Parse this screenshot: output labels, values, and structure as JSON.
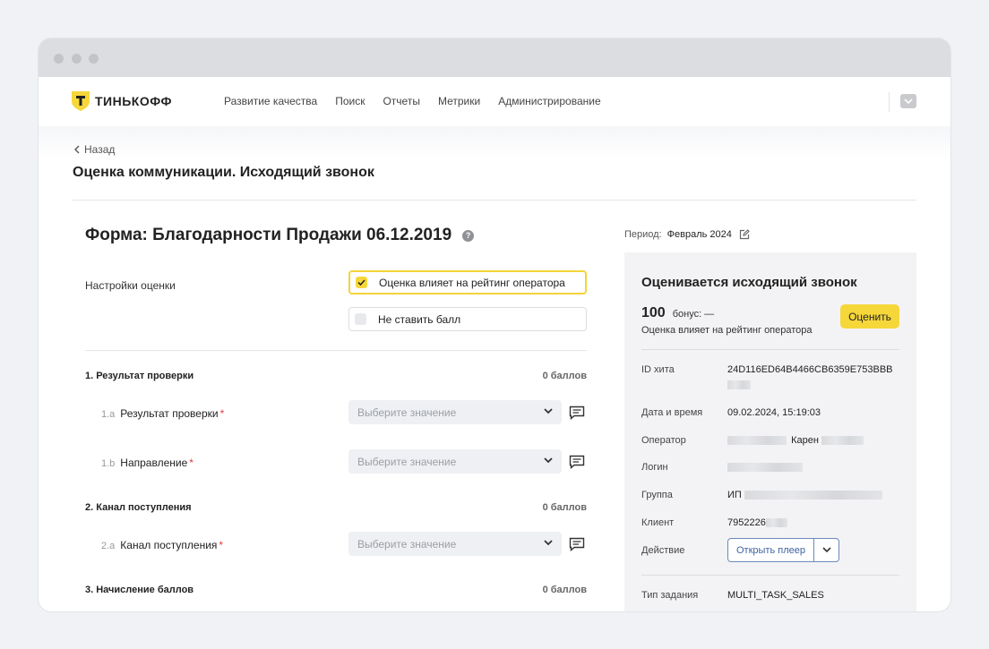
{
  "brand": {
    "name": "ТИНЬКОФФ",
    "accent": "#f6d73a"
  },
  "nav": {
    "items": [
      "Развитие качества",
      "Поиск",
      "Отчеты",
      "Метрики",
      "Администрирование"
    ]
  },
  "header": {
    "back_label": "Назад",
    "title": "Оценка коммуникации. Исходящий звонок"
  },
  "form": {
    "title": "Форма: Благодарности Продажи 06.12.2019",
    "settings_label": "Настройки оценки",
    "options": [
      {
        "label": "Оценка влияет на рейтинг оператора",
        "checked": true
      },
      {
        "label": "Не ставить балл",
        "checked": false
      }
    ],
    "select_placeholder": "Выберите значение",
    "sections": [
      {
        "title": "1.  Результат проверки",
        "score": "0 баллов",
        "items": [
          {
            "num": "1.a",
            "label": "Результат проверки",
            "required": "*"
          },
          {
            "num": "1.b",
            "label": "Направление",
            "required": "*"
          }
        ]
      },
      {
        "title": "2.  Канал поступления",
        "score": "0 баллов",
        "items": [
          {
            "num": "2.a",
            "label": "Канал поступления",
            "required": "*"
          }
        ]
      },
      {
        "title": "3.  Начисление баллов",
        "score": "0 баллов",
        "items": []
      }
    ]
  },
  "sidebar": {
    "period_label": "Период:",
    "period_value": "Февраль 2024",
    "panel_title": "Оценивается исходящий звонок",
    "score": "100",
    "bonus": "бонус: —",
    "influence": "Оценка влияет на рейтинг оператора",
    "rate_button": "Оценить",
    "fields": {
      "hit_id_label": "ID хита",
      "hit_id_value": "24D116ED64B4466CB6359E753BBB",
      "datetime_label": "Дата и время",
      "datetime_value": "09.02.2024, 15:19:03",
      "operator_label": "Оператор",
      "operator_value": "Карен",
      "login_label": "Логин",
      "group_label": "Группа",
      "group_value": "ИП",
      "client_label": "Клиент",
      "client_value": "7952226",
      "action_label": "Действие",
      "action_button": "Открыть плеер",
      "task_type_label": "Тип задания",
      "task_type_value": "MULTI_TASK_SALES"
    }
  }
}
